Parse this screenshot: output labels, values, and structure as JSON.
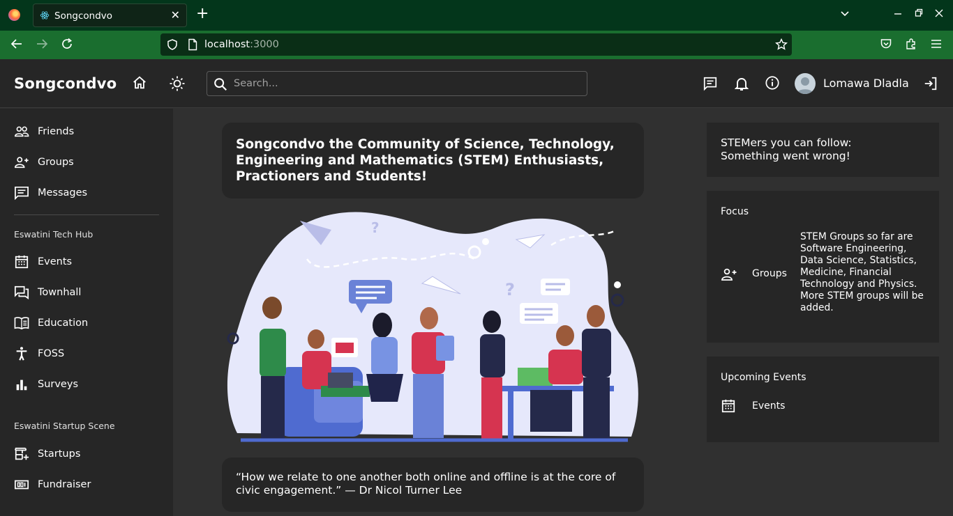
{
  "browser": {
    "tab_title": "Songcondvo",
    "url_host": "localhost",
    "url_port": ":3000"
  },
  "header": {
    "brand": "Songcondvo",
    "search_placeholder": "Search...",
    "username": "Lomawa Dladla"
  },
  "sidebar": {
    "items": [
      {
        "label": "Friends",
        "icon": "people-icon"
      },
      {
        "label": "Groups",
        "icon": "group-add-icon"
      },
      {
        "label": "Messages",
        "icon": "message-icon"
      }
    ],
    "section1_title": "Eswatini Tech Hub",
    "section1_items": [
      {
        "label": "Events",
        "icon": "calendar-icon"
      },
      {
        "label": "Townhall",
        "icon": "forum-icon"
      },
      {
        "label": "Education",
        "icon": "book-icon"
      },
      {
        "label": "FOSS",
        "icon": "accessibility-icon"
      },
      {
        "label": "Surveys",
        "icon": "bar-chart-icon"
      }
    ],
    "section2_title": "Eswatini Startup Scene",
    "section2_items": [
      {
        "label": "Startups",
        "icon": "add-business-icon"
      },
      {
        "label": "Fundraiser",
        "icon": "money-icon"
      }
    ]
  },
  "main": {
    "hero_title": "Songcondvo the Community of Science, Technology, Engineering and Mathematics (STEM) Enthusiasts, Practioners and Students!",
    "quote": "“How we relate to one another both online and offline is at the core of civic engagement.” — Dr Nicol Turner Lee"
  },
  "right": {
    "follow_line1": "STEMers you can follow:",
    "follow_line2": "Something went wrong!",
    "focus_title": "Focus",
    "focus_groups_label": "Groups",
    "focus_desc": "STEM Groups so far are Software Engineering, Data Science, Statistics, Medicine, Financial Technology and Physics. More STEM groups will be added.",
    "events_title": "Upcoming Events",
    "events_label": "Events"
  },
  "colors": {
    "browser_tabbar": "#03361b",
    "browser_navbar": "#1a6e2f",
    "app_surface": "#262626",
    "app_background": "#303030"
  }
}
